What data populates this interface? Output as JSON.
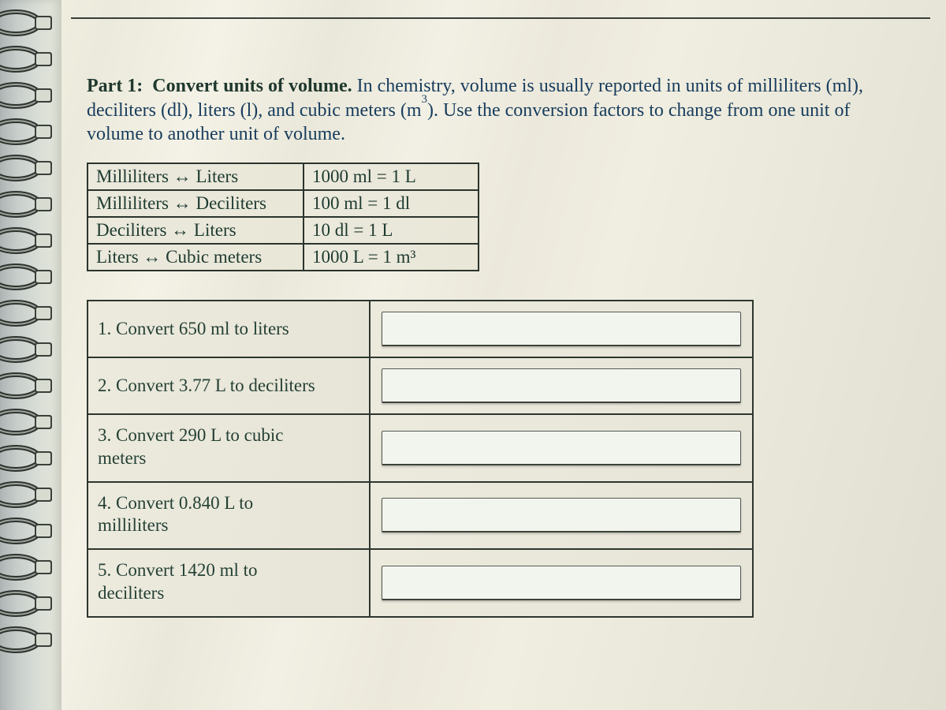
{
  "intro": {
    "part_label": "Part 1:",
    "title": "Convert units of volume.",
    "body_a": "In chemistry, volume is usually reported in units of milliliters (ml), deciliters (dl), liters (l), and cubic meters (m",
    "cube": "3",
    "body_b": "). Use the conversion factors to change from one unit of volume to another unit of volume."
  },
  "conversion_factors": [
    {
      "pair": "Milliliters ↔ Liters",
      "factor": "1000 ml = 1 L"
    },
    {
      "pair": "Milliliters ↔ Deciliters",
      "factor": "100 ml = 1 dl"
    },
    {
      "pair": "Deciliters ↔ Liters",
      "factor": "10 dl = 1 L"
    },
    {
      "pair": "Liters ↔ Cubic meters",
      "factor_html": "1000 L = 1 m³"
    }
  ],
  "problems": [
    {
      "n": "1.",
      "prompt": "Convert 650 ml to liters",
      "lines": 1
    },
    {
      "n": "2.",
      "prompt": "Convert 3.77 L to deciliters",
      "lines": 1
    },
    {
      "n": "3.",
      "prompt": "Convert 290 L to cubic meters",
      "lines": 2,
      "split": [
        "Convert 290 L to cubic",
        "meters"
      ]
    },
    {
      "n": "4.",
      "prompt": "Convert 0.840 L to milliliters",
      "lines": 2,
      "split": [
        "Convert 0.840 L to",
        "milliliters"
      ]
    },
    {
      "n": "5.",
      "prompt": "Convert 1420 ml to deciliters",
      "lines": 2,
      "split": [
        "Convert 1420 ml to",
        "deciliters"
      ]
    }
  ]
}
